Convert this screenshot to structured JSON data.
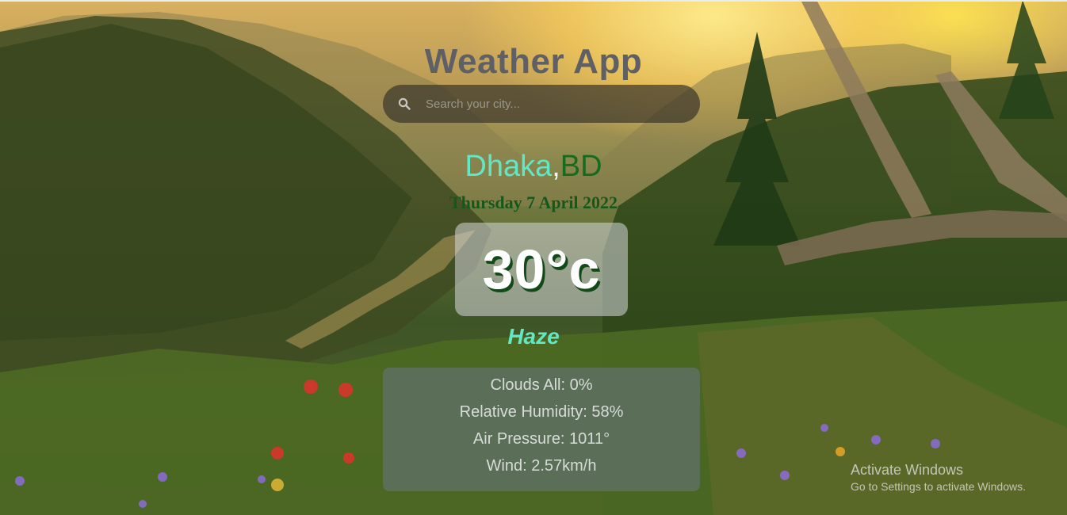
{
  "app": {
    "title": "Weather App"
  },
  "search": {
    "placeholder": "Search your city...",
    "value": ""
  },
  "location": {
    "city": "Dhaka",
    "separator": ",",
    "country": "BD"
  },
  "date": "Thursday 7 April 2022",
  "weather": {
    "temperature": "30°c",
    "condition": "Haze"
  },
  "details": [
    {
      "label": "Clouds All: ",
      "value": "0%"
    },
    {
      "label": "Relative Humidity: ",
      "value": "58%"
    },
    {
      "label": "Air Pressure: ",
      "value": "1011°"
    },
    {
      "label": "Wind: ",
      "value": "2.57km/h"
    }
  ],
  "watermark": {
    "line1": "Activate Windows",
    "line2": "Go to Settings to activate Windows."
  },
  "icons": {
    "search": "search-icon"
  },
  "colors": {
    "title": "#5f6066",
    "city": "#63e6c3",
    "country": "#166b1f",
    "date": "#14581b",
    "condition": "#63e6c3",
    "details_bg": "#5a6e58"
  }
}
